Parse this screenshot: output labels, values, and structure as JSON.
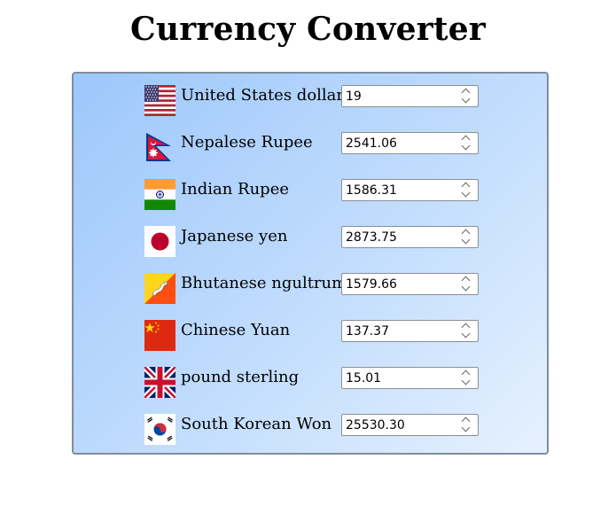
{
  "title": "Currency Converter",
  "currencies": [
    {
      "name": "United States dollar",
      "value": "19",
      "flag": "us-flag-icon"
    },
    {
      "name": "Nepalese Rupee",
      "value": "2541.06",
      "flag": "nepal-flag-icon"
    },
    {
      "name": "Indian Rupee",
      "value": "1586.31",
      "flag": "india-flag-icon"
    },
    {
      "name": "Japanese yen",
      "value": "2873.75",
      "flag": "japan-flag-icon"
    },
    {
      "name": "Bhutanese ngultrum",
      "value": "1579.66",
      "flag": "bhutan-flag-icon"
    },
    {
      "name": "Chinese Yuan",
      "value": "137.37",
      "flag": "china-flag-icon"
    },
    {
      "name": "pound sterling",
      "value": "15.01",
      "flag": "uk-flag-icon"
    },
    {
      "name": "South Korean Won",
      "value": "25530.30",
      "flag": "south-korea-flag-icon"
    }
  ]
}
